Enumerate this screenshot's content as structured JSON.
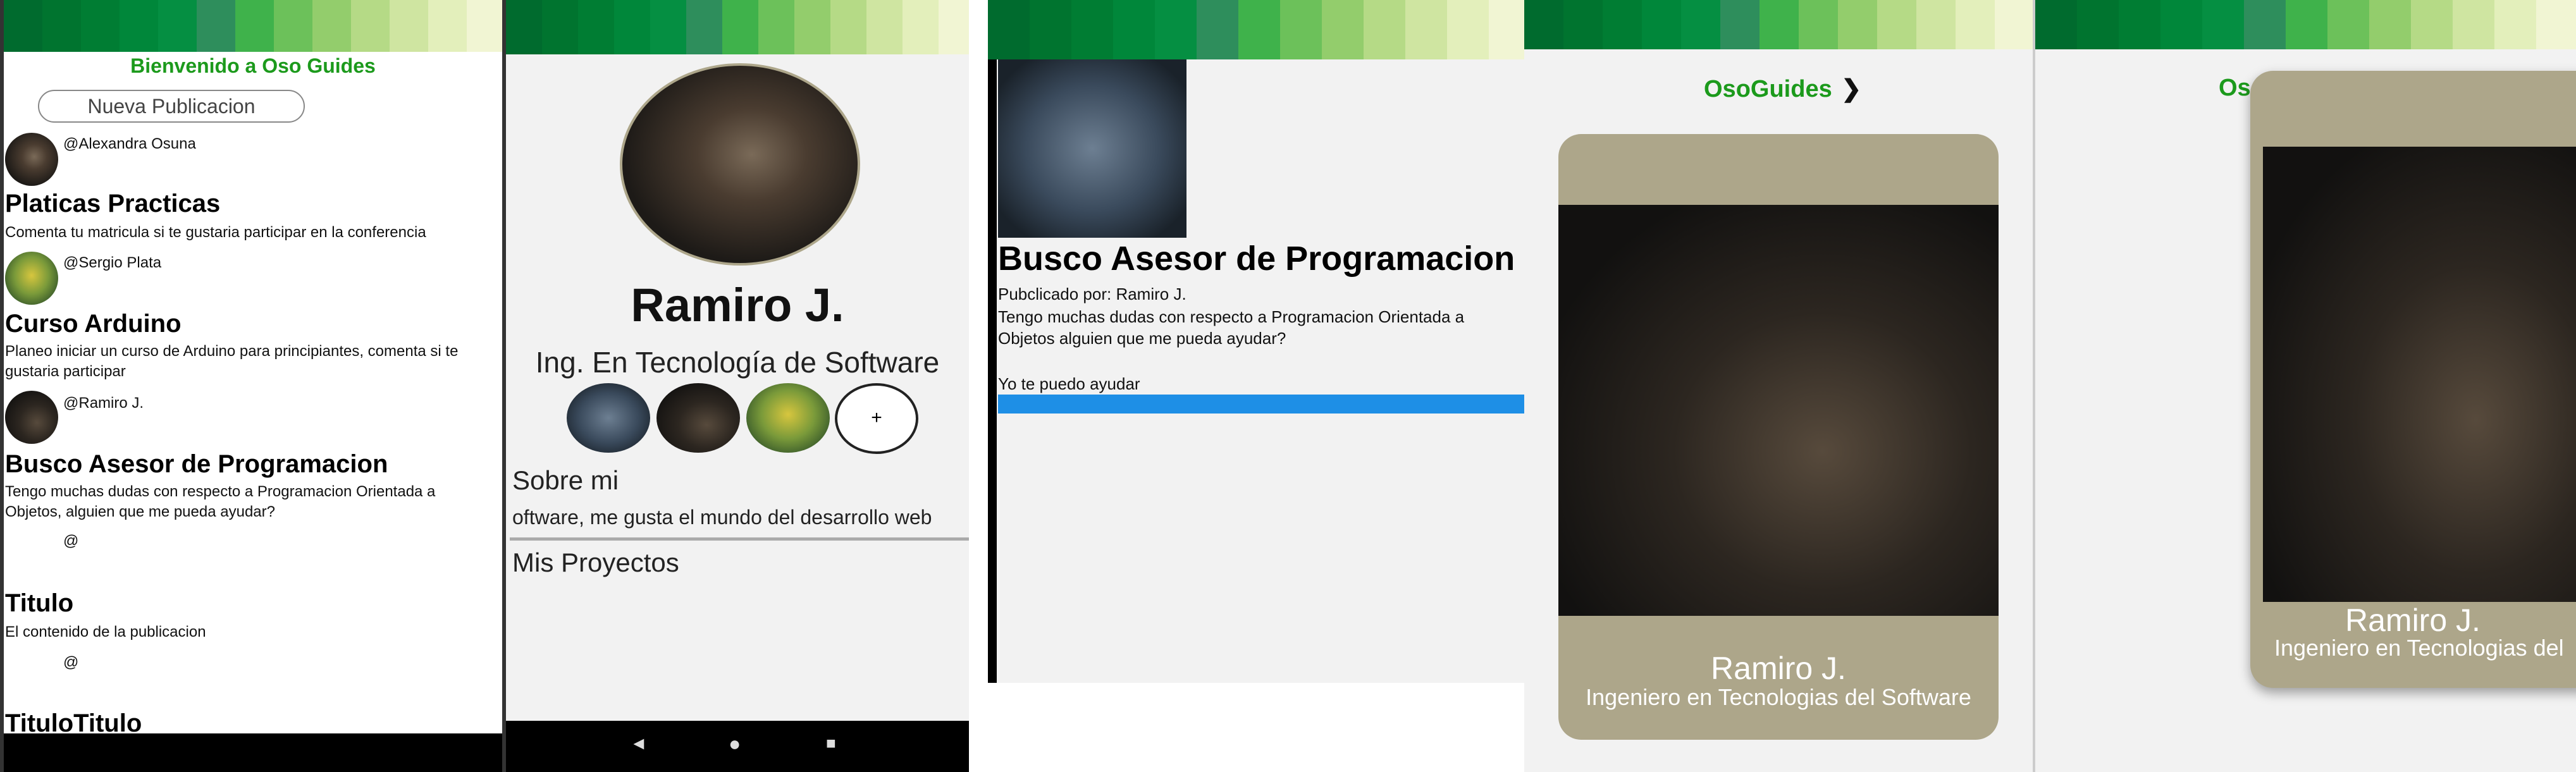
{
  "colors": {
    "stripes": [
      "#006b2e",
      "#00742f",
      "#007d33",
      "#00873a",
      "#058f42",
      "#2e8e5c",
      "#3fb24b",
      "#6cc15a",
      "#93cd6c",
      "#b5da86",
      "#cfe5a1",
      "#e3efbb",
      "#f1f5d3"
    ],
    "brand_green": "#1c9a1c",
    "blue_bar": "#1e8fe6",
    "card": "#ada68a",
    "nav": "#000000"
  },
  "feed": {
    "welcome": "Bienvenido a Oso Guides",
    "new_post_placeholder": "Nueva Publicacion",
    "posts": [
      {
        "handle": "@Alexandra Osuna",
        "title": "Platicas Practicas",
        "body": "Comenta tu matricula si te gustaria participar en la conferencia"
      },
      {
        "handle": "@Sergio Plata",
        "title": "Curso Arduino",
        "body": "Planeo iniciar un curso de Arduino para principiantes, comenta si te gustaria participar"
      },
      {
        "handle": "@Ramiro J.",
        "title": "Busco Asesor de Programacion",
        "body": "Tengo muchas dudas con respecto a Programacion Orientada a Objetos, alguien que me pueda ayudar?"
      },
      {
        "handle": "@",
        "title": "Titulo",
        "body": "El contenido de la publicacion"
      },
      {
        "handle": "@",
        "title": "TituloTitulo",
        "body": ""
      }
    ]
  },
  "profile": {
    "name": "Ramiro J.",
    "career": "Ing. En Tecnología de Software",
    "add_label": "+",
    "about_heading": "Sobre mi",
    "about_text": "oftware, me gusta el mundo del desarrollo web",
    "projects_heading": "Mis Proyectos",
    "nav": {
      "back": "◄",
      "home": "●",
      "recent": "■"
    }
  },
  "post_detail": {
    "title": "Busco Asesor de Programacion",
    "author_line": "Pubclicado por: Ramiro J.",
    "body": "Tengo muchas dudas con respecto a Programacion Orientada a Objetos alguien que me pueda ayudar?",
    "reply": "Yo te puedo ayudar"
  },
  "card_view": {
    "brand": "OsoGuides",
    "brand_partial": "Os",
    "arrow": "❯",
    "name": "Ramiro J.",
    "subtitle": "Ingeniero en Tecnologias del Software",
    "subtitle_partial": "Ingeniero en Tecnologias del"
  }
}
